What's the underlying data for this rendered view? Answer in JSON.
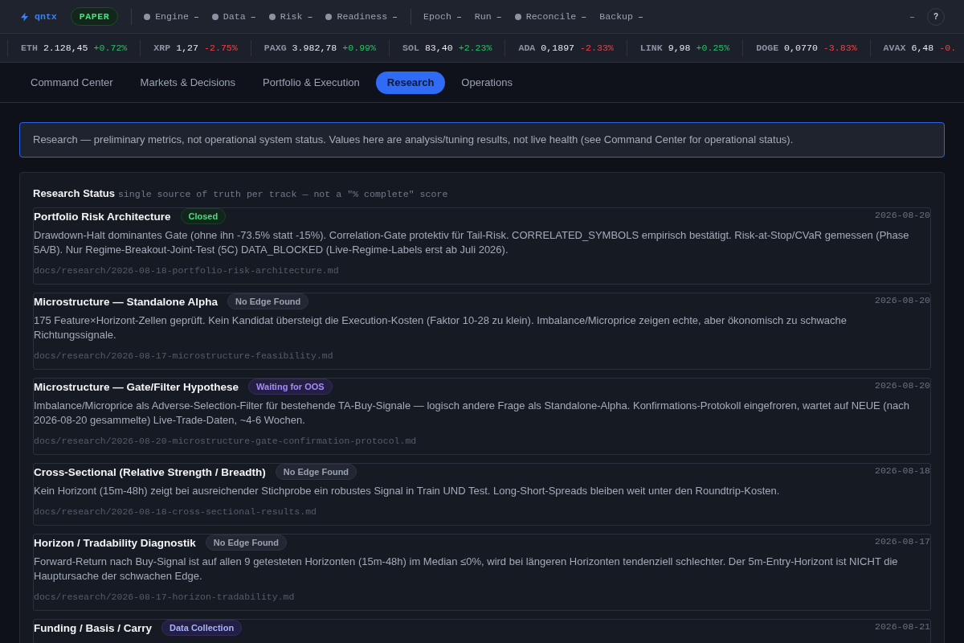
{
  "header": {
    "logo": "qntx",
    "mode_badge": "PAPER",
    "status_groups": [
      [
        {
          "label": "Engine",
          "value": "–",
          "dot": true
        },
        {
          "label": "Data",
          "value": "–",
          "dot": true
        },
        {
          "label": "Risk",
          "value": "–",
          "dot": true
        },
        {
          "label": "Readiness",
          "value": "–",
          "dot": true
        }
      ],
      [
        {
          "label": "Epoch",
          "value": "–",
          "dot": false
        },
        {
          "label": "Run",
          "value": "–",
          "dot": false
        },
        {
          "label": "Reconcile",
          "value": "–",
          "dot": true
        },
        {
          "label": "Backup",
          "value": "–",
          "dot": false
        }
      ]
    ],
    "right_value": "–",
    "help": "?"
  },
  "ticker": [
    {
      "symbol": "ETH",
      "price": "2.128,45",
      "change": "+0.72%",
      "color": "#22c55e"
    },
    {
      "symbol": "XRP",
      "price": "1,27",
      "change": "-2.75%",
      "color": "#ef4444"
    },
    {
      "symbol": "PAXG",
      "price": "3.982,78",
      "change": "+0.99%",
      "color": "#22c55e"
    },
    {
      "symbol": "SOL",
      "price": "83,40",
      "change": "+2.23%",
      "color": "#22c55e"
    },
    {
      "symbol": "ADA",
      "price": "0,1897",
      "change": "-2.33%",
      "color": "#ef4444"
    },
    {
      "symbol": "LINK",
      "price": "9,98",
      "change": "+0.25%",
      "color": "#22c55e"
    },
    {
      "symbol": "DOGE",
      "price": "0,0770",
      "change": "-3.83%",
      "color": "#ef4444"
    },
    {
      "symbol": "AVAX",
      "price": "6,48",
      "change": "-0.",
      "color": "#ef4444"
    }
  ],
  "tabs": [
    {
      "label": "Command Center",
      "selected": false
    },
    {
      "label": "Markets & Decisions",
      "selected": false
    },
    {
      "label": "Portfolio & Execution",
      "selected": false
    },
    {
      "label": "Research",
      "selected": true
    },
    {
      "label": "Operations",
      "selected": false
    }
  ],
  "notice": "Research — preliminary metrics, not operational system status. Values here are analysis/tuning results, not live health (see Command Center for operational status).",
  "research_status": {
    "title": "Research Status",
    "subtitle": "single source of truth per track — not a \"% complete\" score",
    "tracks": [
      {
        "title": "Portfolio Risk Architecture",
        "status": {
          "label": "Closed",
          "kind": "closed"
        },
        "date": "2026-08-20",
        "description": "Drawdown-Halt dominantes Gate (ohne ihn -73.5% statt -15%). Correlation-Gate protektiv für Tail-Risk. CORRELATED_SYMBOLS empirisch bestätigt. Risk-at-Stop/CVaR gemessen (Phase 5A/B). Nur Regime-Breakout-Joint-Test (5C) DATA_BLOCKED (Live-Regime-Labels erst ab Juli 2026).",
        "path": "docs/research/2026-08-18-portfolio-risk-architecture.md"
      },
      {
        "title": "Microstructure — Standalone Alpha",
        "status": {
          "label": "No Edge Found",
          "kind": "no_edge"
        },
        "date": "2026-08-20",
        "description": "175 Feature×Horizont-Zellen geprüft. Kein Kandidat übersteigt die Execution-Kosten (Faktor 10-28 zu klein). Imbalance/Microprice zeigen echte, aber ökonomisch zu schwache Richtungssignale.",
        "path": "docs/research/2026-08-17-microstructure-feasibility.md"
      },
      {
        "title": "Microstructure — Gate/Filter Hypothese",
        "status": {
          "label": "Waiting for OOS",
          "kind": "waiting"
        },
        "date": "2026-08-20",
        "description": "Imbalance/Microprice als Adverse-Selection-Filter für bestehende TA-Buy-Signale — logisch andere Frage als Standalone-Alpha. Konfirmations-Protokoll eingefroren, wartet auf NEUE (nach 2026-08-20 gesammelte) Live-Trade-Daten, ~4-6 Wochen.",
        "path": "docs/research/2026-08-20-microstructure-gate-confirmation-protocol.md"
      },
      {
        "title": "Cross-Sectional (Relative Strength / Breadth)",
        "status": {
          "label": "No Edge Found",
          "kind": "no_edge"
        },
        "date": "2026-08-18",
        "description": "Kein Horizont (15m-48h) zeigt bei ausreichender Stichprobe ein robustes Signal in Train UND Test. Long-Short-Spreads bleiben weit unter den Roundtrip-Kosten.",
        "path": "docs/research/2026-08-18-cross-sectional-results.md"
      },
      {
        "title": "Horizon / Tradability Diagnostik",
        "status": {
          "label": "No Edge Found",
          "kind": "no_edge"
        },
        "date": "2026-08-17",
        "description": "Forward-Return nach Buy-Signal ist auf allen 9 getesteten Horizonten (15m-48h) im Median ≤0%, wird bei längeren Horizonten tendenziell schlechter. Der 5m-Entry-Horizont ist NICHT die Hauptursache der schwachen Edge.",
        "path": "docs/research/2026-08-17-horizon-tradability.md"
      },
      {
        "title": "Funding / Basis / Carry",
        "status": {
          "label": "Data Collection",
          "kind": "collecting"
        },
        "date": "2026-08-21"
      }
    ]
  }
}
